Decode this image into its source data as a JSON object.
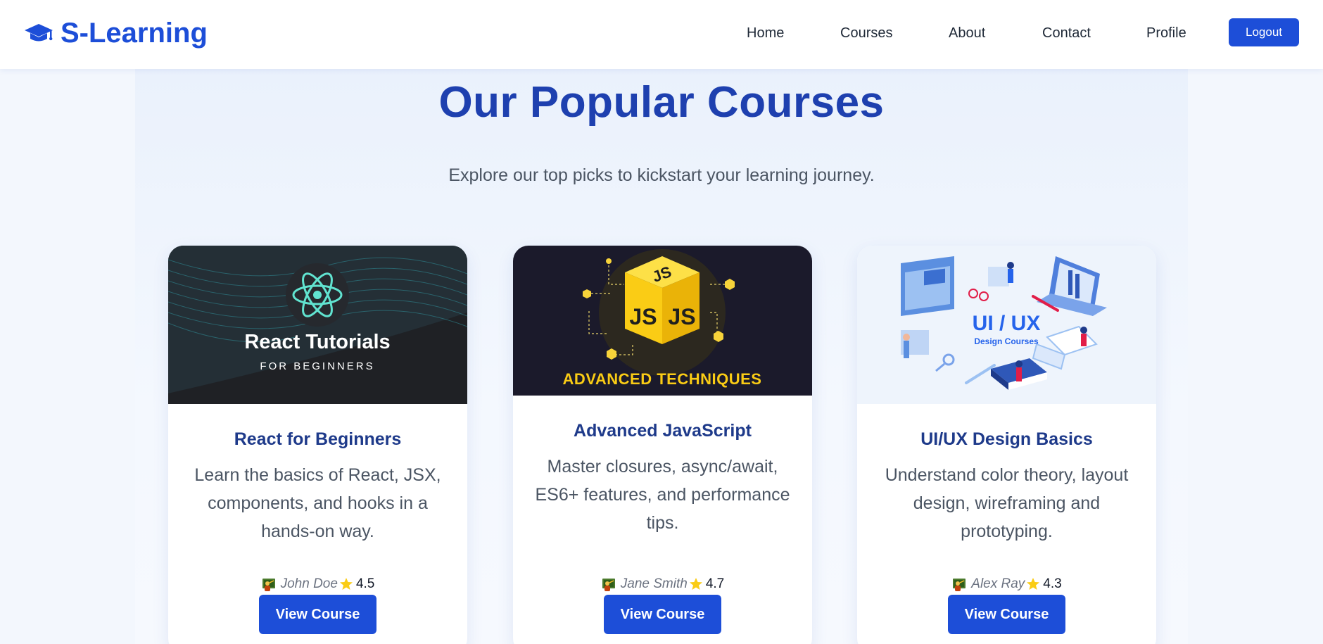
{
  "nav": {
    "brand": "S-Learning",
    "links": [
      "Home",
      "Courses",
      "About",
      "Contact",
      "Profile"
    ],
    "logout_label": "Logout"
  },
  "hero": {
    "title": "Our Popular Courses",
    "subtitle": "Explore our top picks to kickstart your learning journey."
  },
  "courses": [
    {
      "title": "React for Beginners",
      "description": "Learn the basics of React, JSX, components, and hooks in a hands-on way.",
      "instructor": "John Doe",
      "rating": "4.5",
      "button_label": "View Course",
      "image": {
        "heading": "React Tutorials",
        "subheading": "FOR BEGINNERS"
      }
    },
    {
      "title": "Advanced JavaScript",
      "description": "Master closures, async/await, ES6+ features, and performance tips.",
      "instructor": "Jane Smith",
      "rating": "4.7",
      "button_label": "View Course",
      "image": {
        "heading": "ADVANCED TECHNIQUES",
        "badge": "JS"
      }
    },
    {
      "title": "UI/UX Design Basics",
      "description": "Understand color theory, layout design, wireframing and prototyping.",
      "instructor": "Alex Ray",
      "rating": "4.3",
      "button_label": "View Course",
      "image": {
        "heading": "UI / UX",
        "subheading": "Design Courses"
      }
    }
  ],
  "icons": {
    "brand": "graduation-cap-icon",
    "instructor": "teacher-icon",
    "rating": "star-icon"
  },
  "colors": {
    "accent": "#1d4ed8",
    "title": "#1e40af",
    "star": "#facc15"
  }
}
